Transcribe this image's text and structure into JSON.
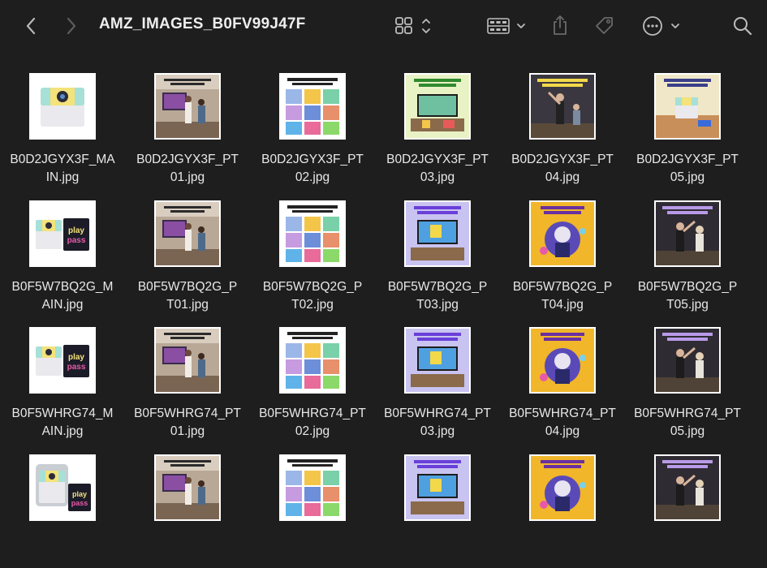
{
  "window": {
    "title": "AMZ_IMAGES_B0FV99J47F",
    "back_icon": "chevron-left-icon",
    "forward_icon": "chevron-right-icon",
    "view_icon": "icon-grid-view-icon",
    "group_icon": "group-by-icon",
    "share_icon": "share-icon",
    "tag_icon": "tag-icon",
    "more_icon": "ellipsis-circle-icon",
    "search_icon": "search-icon"
  },
  "files": [
    {
      "line1": "B0D2JGYX3F_MA",
      "line2": "IN.jpg",
      "thumb": "device"
    },
    {
      "line1": "B0D2JGYX3F_PT",
      "line2": "01.jpg",
      "thumb": "photo"
    },
    {
      "line1": "B0D2JGYX3F_PT",
      "line2": "02.jpg",
      "thumb": "games"
    },
    {
      "line1": "B0D2JGYX3F_PT",
      "line2": "03.jpg",
      "thumb": "starter"
    },
    {
      "line1": "B0D2JGYX3F_PT",
      "line2": "04.jpg",
      "thumb": "body"
    },
    {
      "line1": "B0D2JGYX3F_PT",
      "line2": "05.jpg",
      "thumb": "safe"
    },
    {
      "line1": "B0F5W7BQ2G_M",
      "line2": "AIN.jpg",
      "thumb": "devicebox"
    },
    {
      "line1": "B0F5W7BQ2G_P",
      "line2": "T01.jpg",
      "thumb": "photo"
    },
    {
      "line1": "B0F5W7BQ2G_P",
      "line2": "T02.jpg",
      "thumb": "games"
    },
    {
      "line1": "B0F5W7BQ2G_P",
      "line2": "T03.jpg",
      "thumb": "newgames"
    },
    {
      "line1": "B0F5W7BQ2G_P",
      "line2": "T04.jpg",
      "thumb": "everyone"
    },
    {
      "line1": "B0F5W7BQ2G_P",
      "line2": "T05.jpg",
      "thumb": "body2"
    },
    {
      "line1": "B0F5WHRG74_M",
      "line2": "AIN.jpg",
      "thumb": "devicebox"
    },
    {
      "line1": "B0F5WHRG74_PT",
      "line2": "01.jpg",
      "thumb": "photo"
    },
    {
      "line1": "B0F5WHRG74_PT",
      "line2": "02.jpg",
      "thumb": "games"
    },
    {
      "line1": "B0F5WHRG74_PT",
      "line2": "03.jpg",
      "thumb": "newgames"
    },
    {
      "line1": "B0F5WHRG74_PT",
      "line2": "04.jpg",
      "thumb": "everyone"
    },
    {
      "line1": "B0F5WHRG74_PT",
      "line2": "05.jpg",
      "thumb": "body2"
    },
    {
      "line1": "",
      "line2": "",
      "thumb": "devicecase"
    },
    {
      "line1": "",
      "line2": "",
      "thumb": "photo"
    },
    {
      "line1": "",
      "line2": "",
      "thumb": "games"
    },
    {
      "line1": "",
      "line2": "",
      "thumb": "newgames"
    },
    {
      "line1": "",
      "line2": "",
      "thumb": "everyone"
    },
    {
      "line1": "",
      "line2": "",
      "thumb": "body2"
    }
  ]
}
